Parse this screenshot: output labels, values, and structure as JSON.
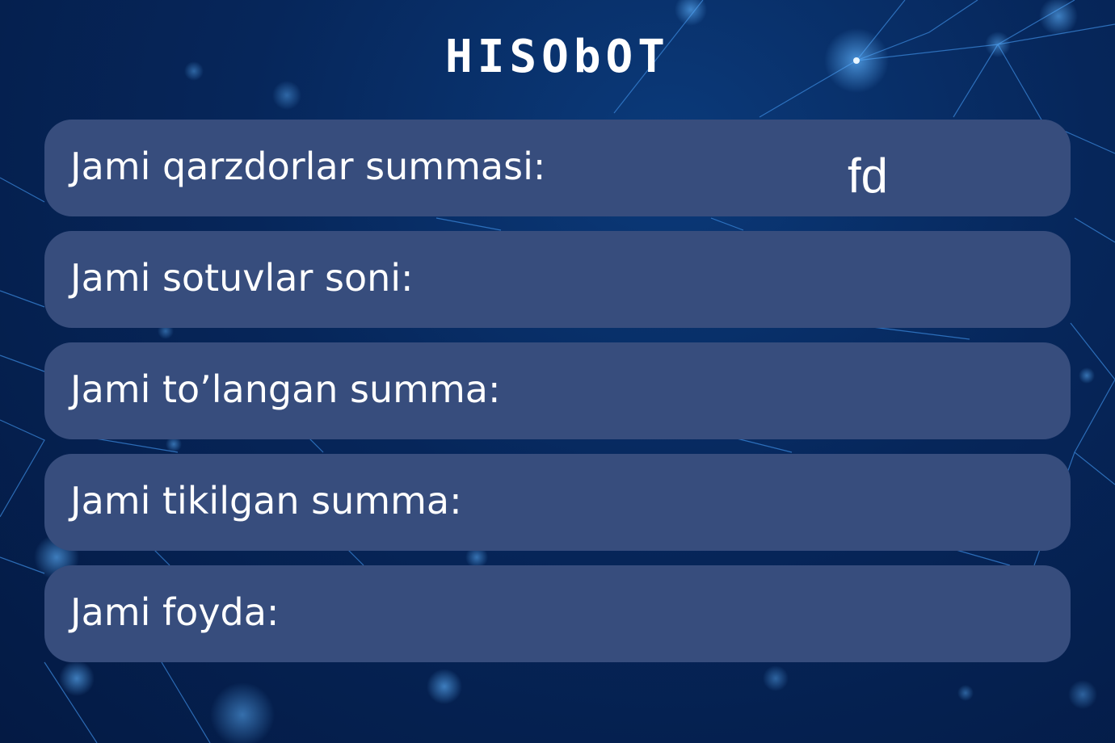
{
  "title": "HISObOT",
  "colors": {
    "background": "#06265a",
    "row_fill": "#374d7d",
    "text": "#ffffff"
  },
  "rows": [
    {
      "label": "Jami qarzdorlar summasi:",
      "value": "fd"
    },
    {
      "label": "Jami sotuvlar soni:",
      "value": ""
    },
    {
      "label": "Jami to’langan summa:",
      "value": ""
    },
    {
      "label": "Jami tikilgan summa:",
      "value": ""
    },
    {
      "label": "Jami foyda:",
      "value": ""
    }
  ]
}
